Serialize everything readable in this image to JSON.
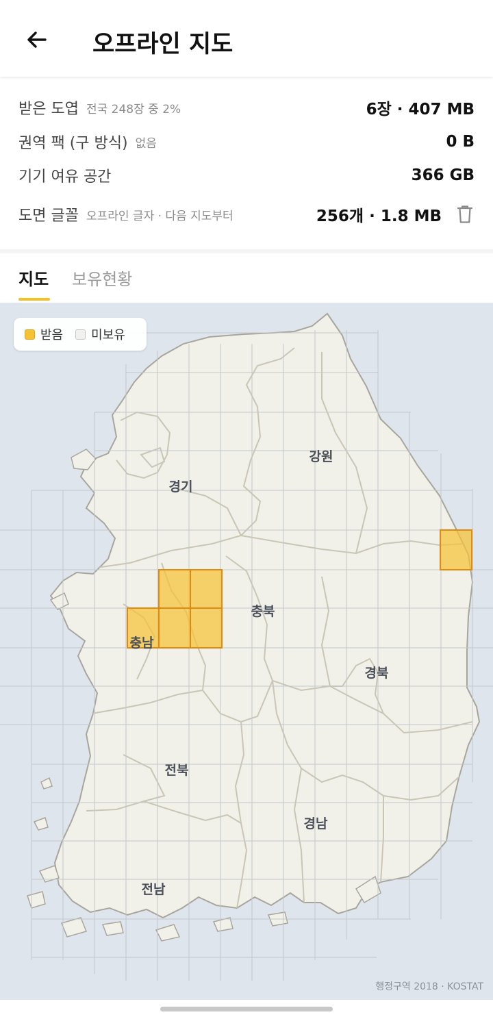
{
  "appbar": {
    "title": "오프라인 지도",
    "back_icon": "arrow-left-icon"
  },
  "info": {
    "rows": [
      {
        "label": "받은 도엽",
        "sub": "전국 248장 중 2%",
        "value": "6장 · 407 MB"
      },
      {
        "label": "권역 팩 (구 방식)",
        "sub": "없음",
        "value": "0 B"
      },
      {
        "label": "기기 여유 공간",
        "sub": "",
        "value": "366 GB"
      },
      {
        "label": "도면 글꼴",
        "sub": "오프라인 글자 · 다음 지도부터",
        "value": "256개 · 1.8 MB",
        "action_icon": "trash-icon"
      }
    ]
  },
  "tabs": [
    {
      "label": "지도",
      "active": true
    },
    {
      "label": "보유현황",
      "active": false
    }
  ],
  "map": {
    "legend": [
      {
        "label": "받음",
        "swatch": "#f6c235"
      },
      {
        "label": "미보유",
        "swatch": "#f1f1ee"
      }
    ],
    "regions": [
      "강원",
      "경기",
      "충북",
      "충남",
      "경북",
      "전북",
      "경남",
      "전남"
    ],
    "downloaded_tiles_count": 6,
    "attribution": "행정구역 2018 · KOSTAT",
    "colors": {
      "sea": "#dfe5ec",
      "land": "#f1f0e9",
      "border": "#c9c6b6",
      "grid": "#c3c8cc",
      "downloaded_fill": "#f6c235",
      "downloaded_stroke": "#e08a10"
    }
  }
}
